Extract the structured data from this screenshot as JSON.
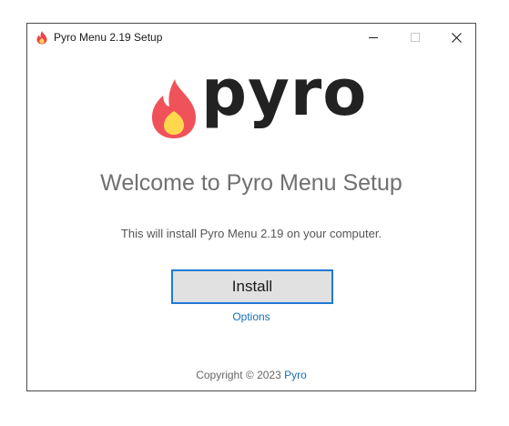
{
  "window": {
    "title": "Pyro Menu 2.19 Setup",
    "controls": {
      "minimize_icon": "minimize-icon",
      "maximize_icon": "maximize-icon",
      "close_icon": "close-icon"
    }
  },
  "logo": {
    "wordmark": "pyro",
    "icon": "flame-icon"
  },
  "main": {
    "heading": "Welcome to Pyro Menu Setup",
    "description": "This will install Pyro Menu 2.19 on your computer.",
    "install_label": "Install",
    "options_label": "Options"
  },
  "footer": {
    "copyright_prefix": "Copyright © 2023 ",
    "copyright_link": "Pyro"
  },
  "colors": {
    "accent_blue": "#1f7ad4",
    "link_blue": "#1a6fb5",
    "flame_red": "#f0525a",
    "flame_yellow": "#ffd84d",
    "wordmark": "#222222"
  }
}
